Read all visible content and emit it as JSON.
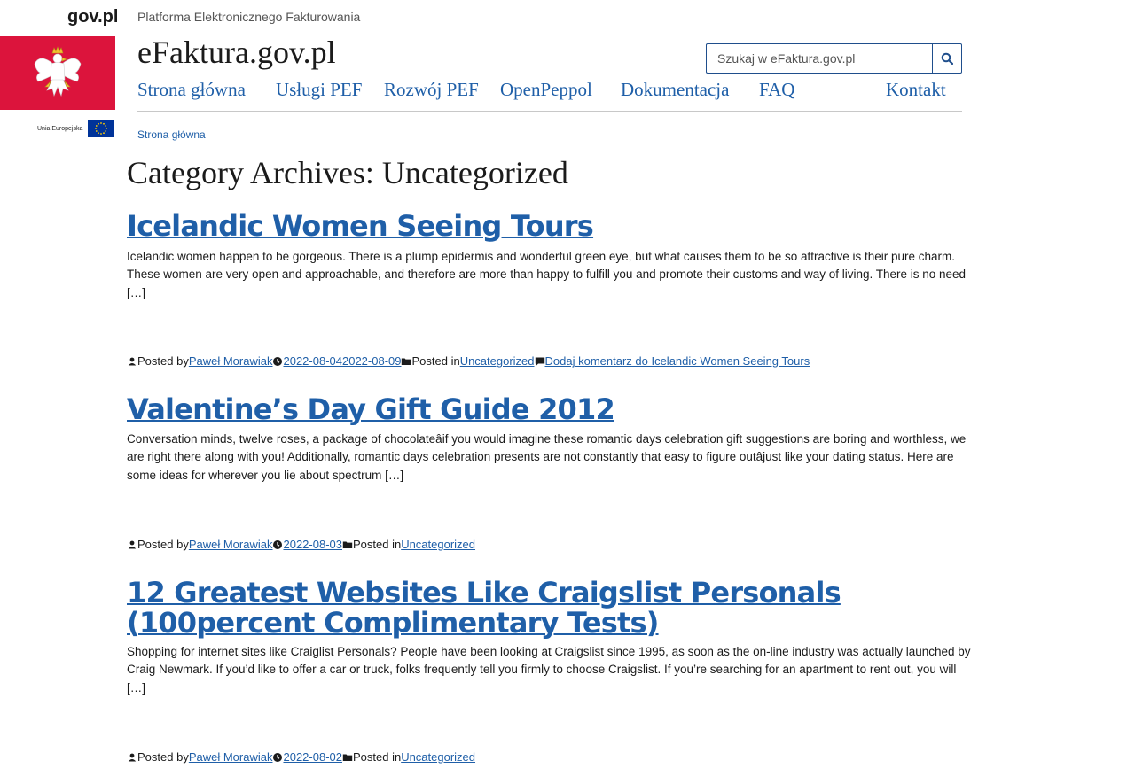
{
  "header": {
    "govpl": "gov.pl",
    "platform": "Platforma Elektronicznego Fakturowania",
    "site_title": "eFaktura.gov.pl",
    "eu_label": "Unia Europejska",
    "search_placeholder": "Szukaj w eFaktura.gov.pl"
  },
  "nav": {
    "items": [
      {
        "label": "Strona główna"
      },
      {
        "label": "Usługi PEF"
      },
      {
        "label": "Rozwój PEF"
      },
      {
        "label": "OpenPeppol"
      },
      {
        "label": "Dokumentacja"
      },
      {
        "label": "FAQ"
      },
      {
        "label": "Kontakt"
      }
    ]
  },
  "breadcrumb": "Strona główna",
  "archive_title": "Category Archives: Uncategorized",
  "posts": [
    {
      "title": "Icelandic Women Seeing Tours",
      "excerpt": "Icelandic women happen to be gorgeous. There is a plump epidermis and wonderful green eye, but what causes them to be so attractive is their pure charm. These women are very open and approachable, and therefore are more than happy to fulfill you and promote their customs and way of living. There is no need […]",
      "posted_by_label": "Posted by",
      "author": "Paweł Morawiak",
      "date": "2022-08-042022-08-09",
      "posted_in_label": "Posted in",
      "category": "Uncategorized",
      "comment_link": "Dodaj komentarz do Icelandic Women Seeing Tours"
    },
    {
      "title": "Valentine’s Day Gift Guide 2012",
      "excerpt": "Conversation minds, twelve roses, a package of chocolateâif you would imagine these romantic days celebration gift suggestions are boring and worthless, we are right there along with you!  Additionally, romantic days celebration presents are not constantly that easy to figure outâjust like your dating status.  Here are some ideas for wherever you lie about spectrum […]",
      "posted_by_label": "Posted by",
      "author": "Paweł Morawiak",
      "date": "2022-08-03",
      "posted_in_label": "Posted in",
      "category": "Uncategorized"
    },
    {
      "title": "12 Greatest Websites Like Craigslist Personals (100percent Complimentary Tests)",
      "excerpt": "Shopping for internet sites like Craiglist Personals? People have been looking at Craigslist since 1995, as soon as the on-line industry was actually launched by Craig Newmark. If you’d like to offer a car or truck, folks frequently tell you firmly to choose Craigslist. If you’re searching for an apartment to rent out, you will […]",
      "posted_by_label": "Posted by",
      "author": "Paweł Morawiak",
      "date": "2022-08-02",
      "posted_in_label": "Posted in",
      "category": "Uncategorized"
    }
  ],
  "colors": {
    "brand_red": "#dc143c",
    "link_blue": "#1f5fa8",
    "search_border": "#1f4e8c"
  }
}
